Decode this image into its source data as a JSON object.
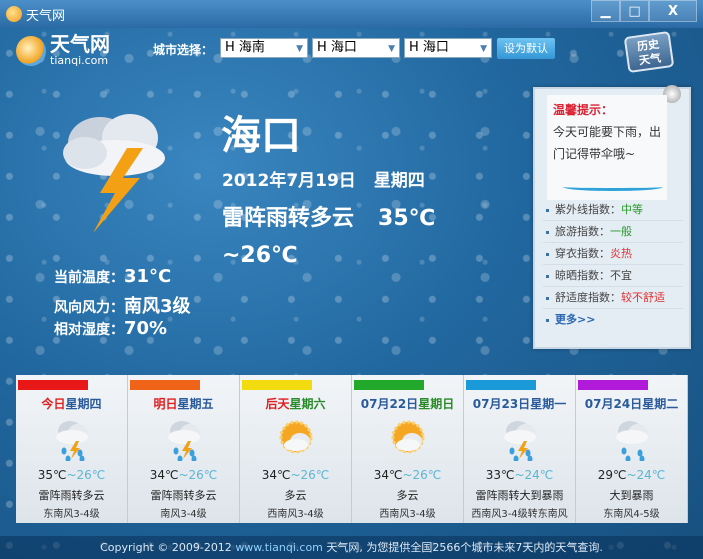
{
  "window": {
    "title": "天气网",
    "minimize": "▁",
    "maximize": "□",
    "close": "X"
  },
  "brand": {
    "name": "天气网",
    "domain": "tianqi.com"
  },
  "toolbar": {
    "city_label": "城市选择：",
    "province": "H  海南",
    "city": "H  海口",
    "district": "H  海口",
    "set_default": "设为默认",
    "history": [
      "历史",
      "天气"
    ]
  },
  "current": {
    "city": "海口",
    "date": "2012年7月19日",
    "weekday": "星期四",
    "weather": "雷阵雨转多云",
    "high": "35℃",
    "low": "~26℃",
    "details": [
      {
        "label": "当前温度：",
        "value": "31°C"
      },
      {
        "label": "风向风力：",
        "value": "南风3级"
      },
      {
        "label": "相对湿度：",
        "value": "70%"
      }
    ]
  },
  "tip": {
    "title": "温馨提示：",
    "text": "今天可能要下雨，出门记得带伞哦~",
    "indices": [
      {
        "label": "紫外线指数：",
        "value": "中等",
        "color": "#2a9a2a"
      },
      {
        "label": "旅游指数：",
        "value": "一般",
        "color": "#2a9a2a"
      },
      {
        "label": "穿衣指数：",
        "value": "炎热",
        "color": "#e03030"
      },
      {
        "label": "晾晒指数：",
        "value": "不宜",
        "color": "#444444"
      },
      {
        "label": "舒适度指数：",
        "value": "较不舒适",
        "color": "#e03030"
      }
    ],
    "more": "更多>>"
  },
  "forecast": [
    {
      "prefix": "今日",
      "day": "星期四",
      "prefix_color": "#e02020",
      "day_color": "#2a5a9a",
      "bar": "#e81818",
      "icon": "thunderstorm-icon",
      "high": "35℃",
      "low": "~26℃",
      "desc": "雷阵雨转多云",
      "wind": "东南风3-4级"
    },
    {
      "prefix": "明日",
      "day": "星期五",
      "prefix_color": "#e02020",
      "day_color": "#2a5a9a",
      "bar": "#f0641a",
      "icon": "thunderstorm-icon",
      "high": "34℃",
      "low": "~26℃",
      "desc": "雷阵雨转多云",
      "wind": "南风3-4级"
    },
    {
      "prefix": "后天",
      "day": "星期六",
      "prefix_color": "#e02020",
      "day_color": "#2a8a2a",
      "bar": "#f2dc10",
      "icon": "partly-cloudy-icon",
      "high": "34℃",
      "low": "~26℃",
      "desc": "多云",
      "wind": "西南风3-4级"
    },
    {
      "prefix": "07月22日",
      "day": "星期日",
      "prefix_color": "#2a5a9a",
      "day_color": "#2a8a2a",
      "bar": "#22a82a",
      "icon": "partly-cloudy-icon",
      "high": "34℃",
      "low": "~26℃",
      "desc": "多云",
      "wind": "西南风3-4级"
    },
    {
      "prefix": "07月23日",
      "day": "星期一",
      "prefix_color": "#2a5a9a",
      "day_color": "#2a5a9a",
      "bar": "#1a9ad8",
      "icon": "thunderstorm-icon",
      "high": "33℃",
      "low": "~24℃",
      "desc": "雷阵雨转大到暴雨",
      "wind": "西南风3-4级转东南风"
    },
    {
      "prefix": "07月24日",
      "day": "星期二",
      "prefix_color": "#2a5a9a",
      "day_color": "#2a5a9a",
      "bar": "#b01ad8",
      "icon": "heavy-rain-icon",
      "high": "29℃",
      "low": "~24℃",
      "desc": "大到暴雨",
      "wind": "东南风4-5级"
    }
  ],
  "footer": {
    "pre": "Copyright © 2009-2012 ",
    "url": "www.tianqi.com",
    "post": " 天气网, 为您提供全国2566个城市未来7天内的天气查询."
  }
}
